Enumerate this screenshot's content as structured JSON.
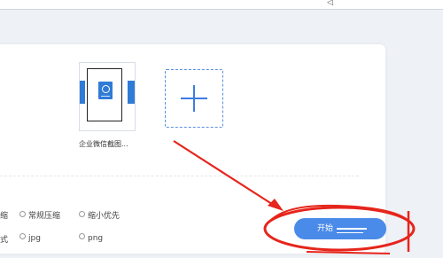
{
  "file": {
    "name": "企业微信截图..."
  },
  "options": {
    "row1_cut": "缩",
    "row1": [
      "常规压缩",
      "缩小优先"
    ],
    "row2_cut": "式",
    "row2": [
      "jpg",
      "png"
    ]
  },
  "start_button": {
    "label": "开始"
  },
  "colors": {
    "accent": "#4a8ae8",
    "annotation": "#e6251c"
  }
}
